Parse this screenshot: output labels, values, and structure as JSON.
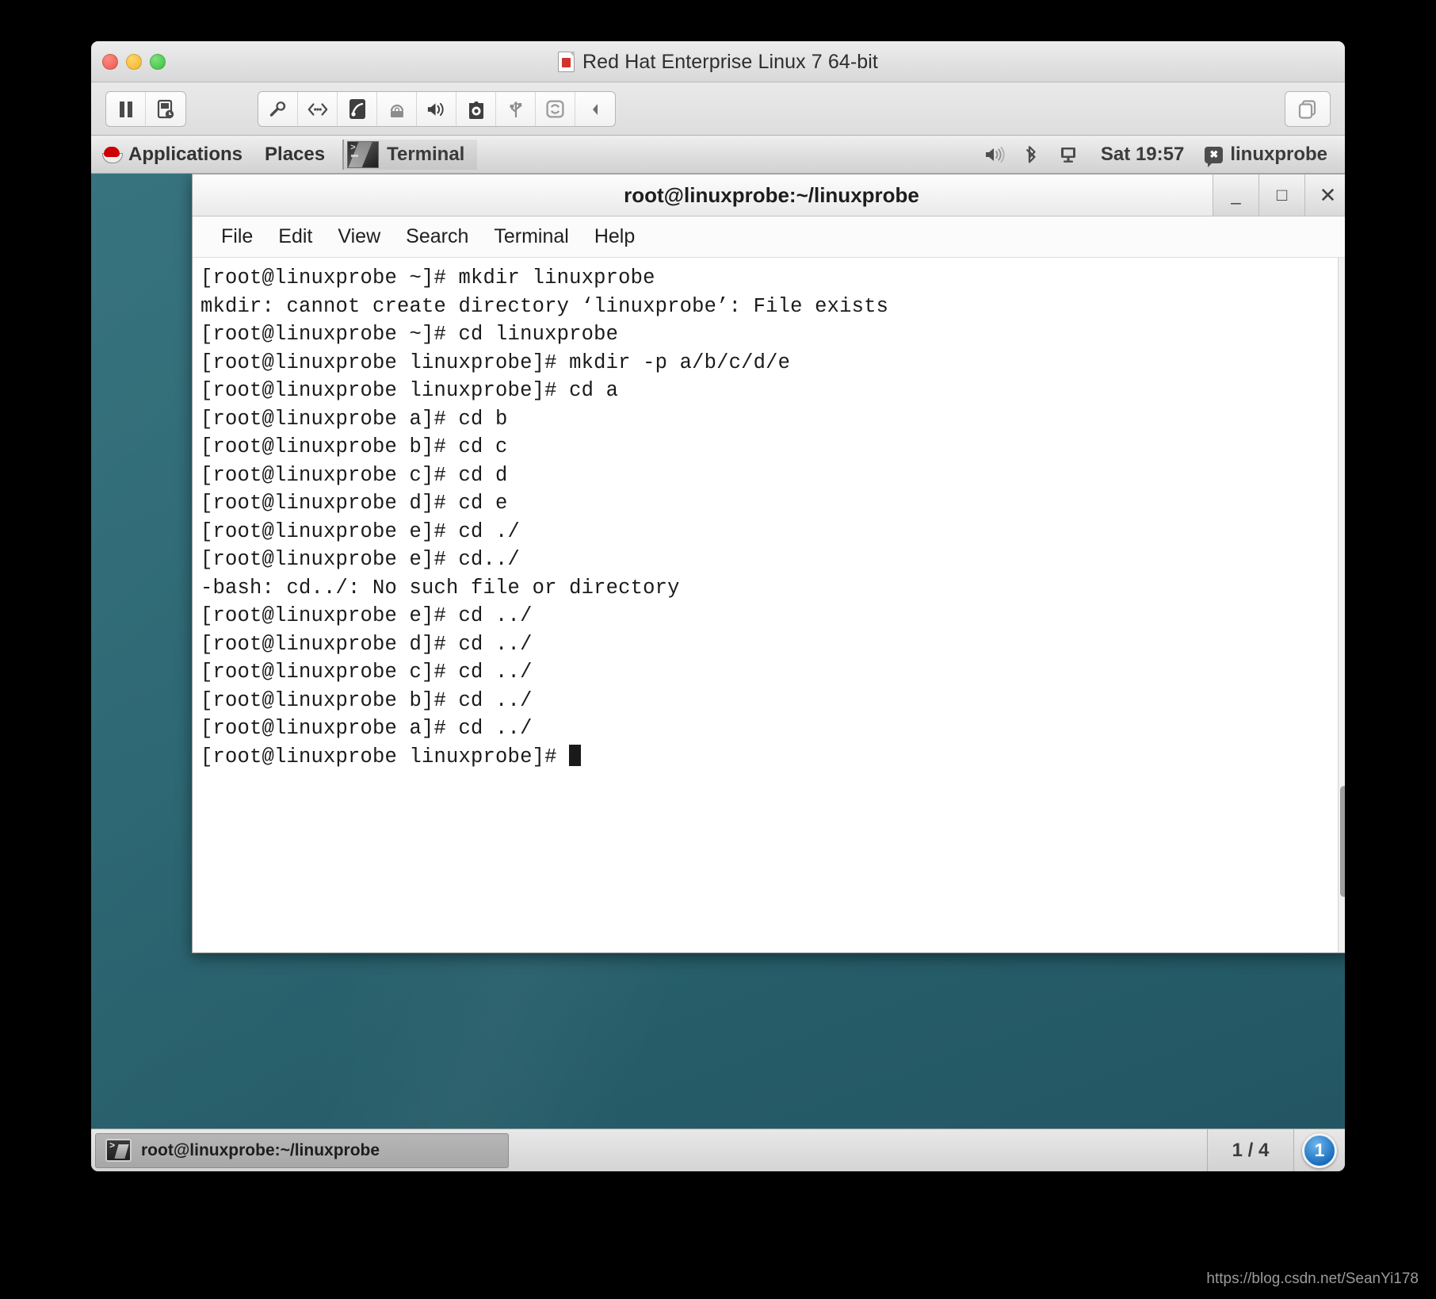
{
  "vm_window": {
    "title": "Red Hat Enterprise Linux 7 64-bit",
    "title_icon": "vm-document-icon",
    "traffic_lights": [
      {
        "name": "close",
        "color": "#e8584c"
      },
      {
        "name": "minimize",
        "color": "#f0b429"
      },
      {
        "name": "zoom",
        "color": "#39c13a"
      }
    ],
    "toolbar_left": [
      {
        "name": "pause-icon",
        "label": "Pause"
      },
      {
        "name": "snapshot-icon",
        "label": "Snapshot"
      }
    ],
    "toolbar_middle": [
      {
        "name": "settings-wrench-icon",
        "label": "Settings"
      },
      {
        "name": "network-icon",
        "label": "Network Adapter"
      },
      {
        "name": "hard-disk-icon",
        "label": "Hard Disk"
      },
      {
        "name": "cd-dvd-icon",
        "label": "CD/DVD"
      },
      {
        "name": "sound-icon",
        "label": "Sound Card"
      },
      {
        "name": "camera-icon",
        "label": "Camera"
      },
      {
        "name": "usb-icon",
        "label": "USB Devices"
      },
      {
        "name": "shared-folders-icon",
        "label": "Sharing"
      },
      {
        "name": "collapse-chevron-icon",
        "label": "Collapse"
      }
    ],
    "toolbar_right": [
      {
        "name": "unity-view-icon",
        "label": "Single Window / Unity"
      }
    ]
  },
  "gnome_panel": {
    "applications_label": "Applications",
    "places_label": "Places",
    "window_button": {
      "label": "Terminal",
      "icon": "terminal-thumbnail-icon"
    },
    "status_icons": [
      {
        "name": "volume-icon",
        "label": "Volume"
      },
      {
        "name": "bluetooth-icon",
        "label": "Bluetooth"
      },
      {
        "name": "display-icon",
        "label": "Display"
      }
    ],
    "clock": "Sat 19:57",
    "user": "linuxprobe",
    "user_icon": "chat-bubble-icon"
  },
  "terminal_window": {
    "title": "root@linuxprobe:~/linuxprobe",
    "window_controls": [
      {
        "name": "minimize-button",
        "glyph": "_"
      },
      {
        "name": "maximize-button",
        "glyph": "□"
      },
      {
        "name": "close-button",
        "glyph": "✕"
      }
    ],
    "menu": [
      "File",
      "Edit",
      "View",
      "Search",
      "Terminal",
      "Help"
    ],
    "lines": [
      "[root@linuxprobe ~]# mkdir linuxprobe",
      "mkdir: cannot create directory ‘linuxprobe’: File exists",
      "[root@linuxprobe ~]# cd linuxprobe",
      "[root@linuxprobe linuxprobe]# mkdir -p a/b/c/d/e",
      "[root@linuxprobe linuxprobe]# cd a",
      "[root@linuxprobe a]# cd b",
      "[root@linuxprobe b]# cd c",
      "[root@linuxprobe c]# cd d",
      "[root@linuxprobe d]# cd e",
      "[root@linuxprobe e]# cd ./",
      "[root@linuxprobe e]# cd../",
      "-bash: cd../: No such file or directory",
      "[root@linuxprobe e]# cd ../",
      "[root@linuxprobe d]# cd ../",
      "[root@linuxprobe c]# cd ../",
      "[root@linuxprobe b]# cd ../",
      "[root@linuxprobe a]# cd ../"
    ],
    "prompt_last": "[root@linuxprobe linuxprobe]# "
  },
  "gnome_taskbar": {
    "window_button_label": "root@linuxprobe:~/linuxprobe",
    "window_button_icon": "terminal-icon",
    "workspace_indicator": "1 / 4",
    "workspace_badge": "1"
  },
  "watermark": "https://blog.csdn.net/SeanYi178",
  "colors": {
    "desktop_teal": "#2a6571",
    "panel_gray": "#dcdcdc",
    "badge_blue": "#1a6fc0",
    "redhat_red": "#cc0000"
  }
}
